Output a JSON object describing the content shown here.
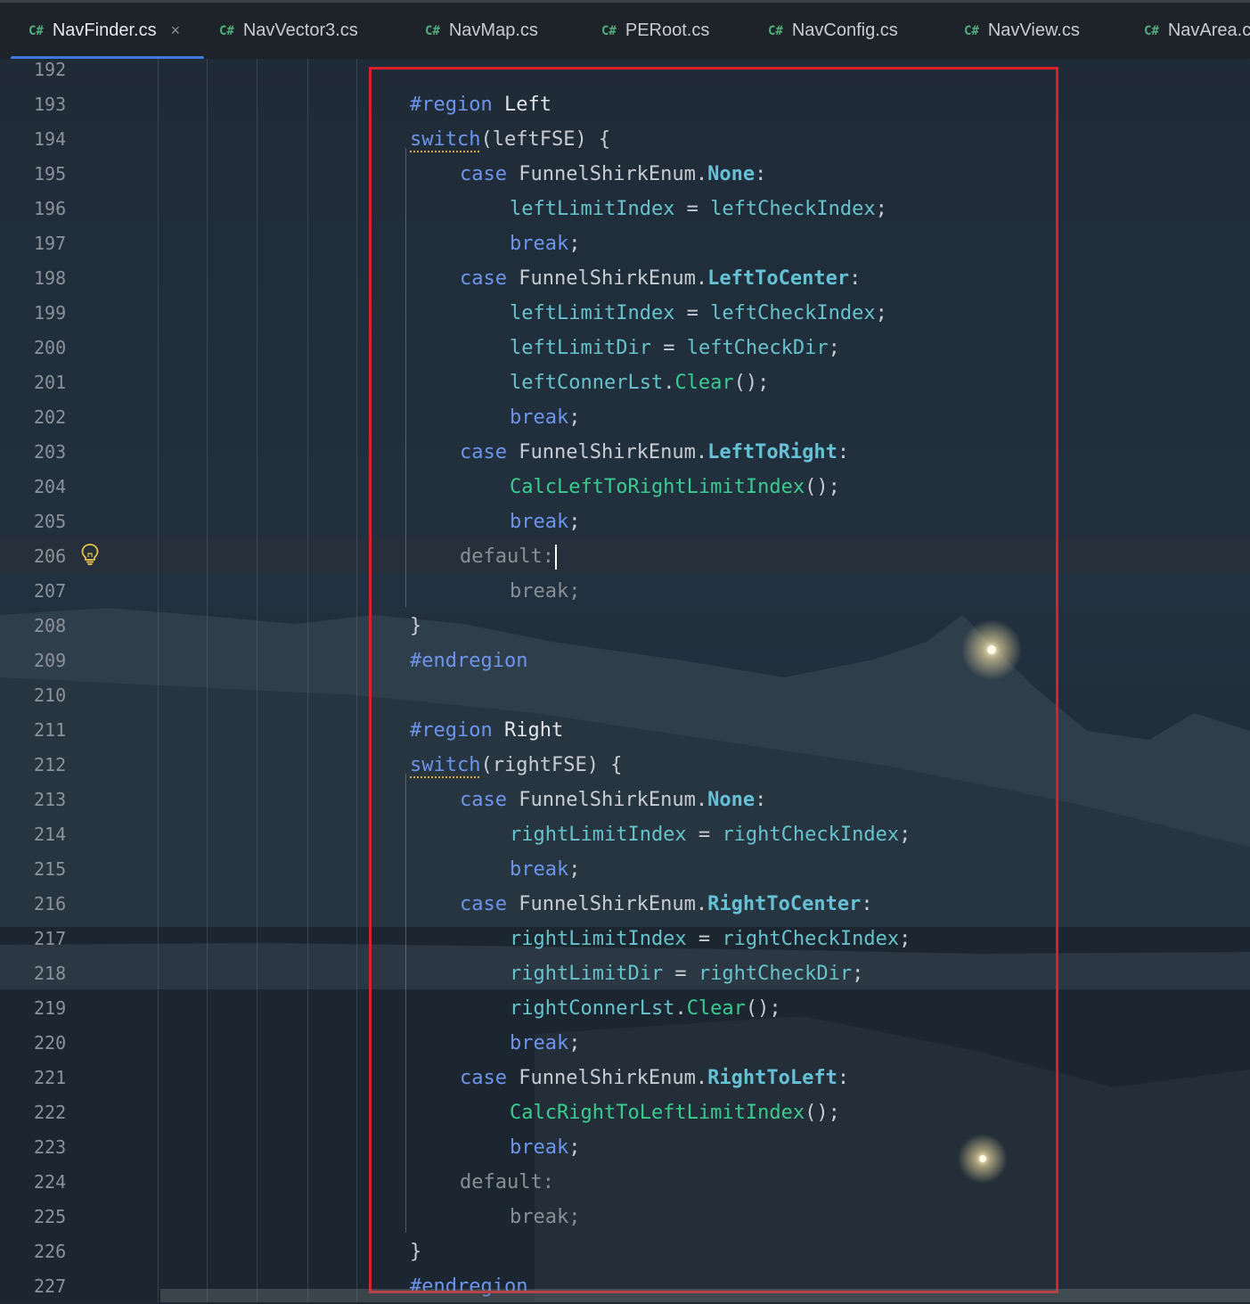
{
  "tabs": [
    {
      "lang": "C#",
      "label": "NavFinder.cs",
      "close": "×"
    },
    {
      "lang": "C#",
      "label": "NavVector3.cs"
    },
    {
      "lang": "C#",
      "label": "NavMap.cs"
    },
    {
      "lang": "C#",
      "label": "PERoot.cs"
    },
    {
      "lang": "C#",
      "label": "NavConfig.cs"
    },
    {
      "lang": "C#",
      "label": "NavView.cs"
    },
    {
      "lang": "C#",
      "label": "NavArea.c"
    }
  ],
  "line_numbers": [
    "192",
    "193",
    "194",
    "195",
    "196",
    "197",
    "198",
    "199",
    "200",
    "201",
    "202",
    "203",
    "204",
    "205",
    "206",
    "207",
    "208",
    "209",
    "210",
    "211",
    "212",
    "213",
    "214",
    "215",
    "216",
    "217",
    "218",
    "219",
    "220",
    "221",
    "222",
    "223",
    "224",
    "225",
    "226",
    "227"
  ],
  "code": {
    "l193": {
      "directive": "#region",
      "name": "Left"
    },
    "l194": {
      "kw": "switch",
      "arg": "(leftFSE) {"
    },
    "l195": {
      "kw": "case",
      "type": "FunnelShirkEnum",
      "dot": ".",
      "member": "None",
      "colon": ":"
    },
    "l196": {
      "lhs": "leftLimitIndex",
      "op": " = ",
      "rhs": "leftCheckIndex",
      "end": ";"
    },
    "l197": {
      "kw": "break",
      "end": ";"
    },
    "l198": {
      "kw": "case",
      "type": "FunnelShirkEnum",
      "dot": ".",
      "member": "LeftToCenter",
      "colon": ":"
    },
    "l199": {
      "lhs": "leftLimitIndex",
      "op": " = ",
      "rhs": "leftCheckIndex",
      "end": ";"
    },
    "l200": {
      "lhs": "leftLimitDir",
      "op": " = ",
      "rhs": "leftCheckDir",
      "end": ";"
    },
    "l201": {
      "obj": "leftConnerLst",
      "dot": ".",
      "fn": "Clear",
      "end": "();"
    },
    "l202": {
      "kw": "break",
      "end": ";"
    },
    "l203": {
      "kw": "case",
      "type": "FunnelShirkEnum",
      "dot": ".",
      "member": "LeftToRight",
      "colon": ":"
    },
    "l204": {
      "fn": "CalcLeftToRightLimitIndex",
      "end": "();"
    },
    "l205": {
      "kw": "break",
      "end": ";"
    },
    "l206": {
      "kw": "default:"
    },
    "l207": {
      "kw": "break;"
    },
    "l208": {
      "brace": "}"
    },
    "l209": {
      "directive": "#endregion"
    },
    "l211": {
      "directive": "#region",
      "name": "Right"
    },
    "l212": {
      "kw": "switch",
      "arg": "(rightFSE) {"
    },
    "l213": {
      "kw": "case",
      "type": "FunnelShirkEnum",
      "dot": ".",
      "member": "None",
      "colon": ":"
    },
    "l214": {
      "lhs": "rightLimitIndex",
      "op": " = ",
      "rhs": "rightCheckIndex",
      "end": ";"
    },
    "l215": {
      "kw": "break",
      "end": ";"
    },
    "l216": {
      "kw": "case",
      "type": "FunnelShirkEnum",
      "dot": ".",
      "member": "RightToCenter",
      "colon": ":"
    },
    "l217": {
      "lhs": "rightLimitIndex",
      "op": " = ",
      "rhs": "rightCheckIndex",
      "end": ";"
    },
    "l218": {
      "lhs": "rightLimitDir",
      "op": " = ",
      "rhs": "rightCheckDir",
      "end": ";"
    },
    "l219": {
      "obj": "rightConnerLst",
      "dot": ".",
      "fn": "Clear",
      "end": "();"
    },
    "l220": {
      "kw": "break",
      "end": ";"
    },
    "l221": {
      "kw": "case",
      "type": "FunnelShirkEnum",
      "dot": ".",
      "member": "RightToLeft",
      "colon": ":"
    },
    "l222": {
      "fn": "CalcRightToLeftLimitIndex",
      "end": "();"
    },
    "l223": {
      "kw": "break",
      "end": ";"
    },
    "l224": {
      "kw": "default:"
    },
    "l225": {
      "kw": "break;"
    },
    "l226": {
      "brace": "}"
    },
    "l227": {
      "directive": "#endregion"
    }
  },
  "colors": {
    "keyword": "#6c95eb",
    "enum_member": "#65c1d6",
    "variable": "#66c3cc",
    "method": "#39cc8f",
    "tab_active_underline": "#3d7be0",
    "highlight_box": "#d8222a"
  },
  "icons": {
    "tab_language": "csharp-file-icon",
    "gutter": "lightbulb-icon"
  }
}
